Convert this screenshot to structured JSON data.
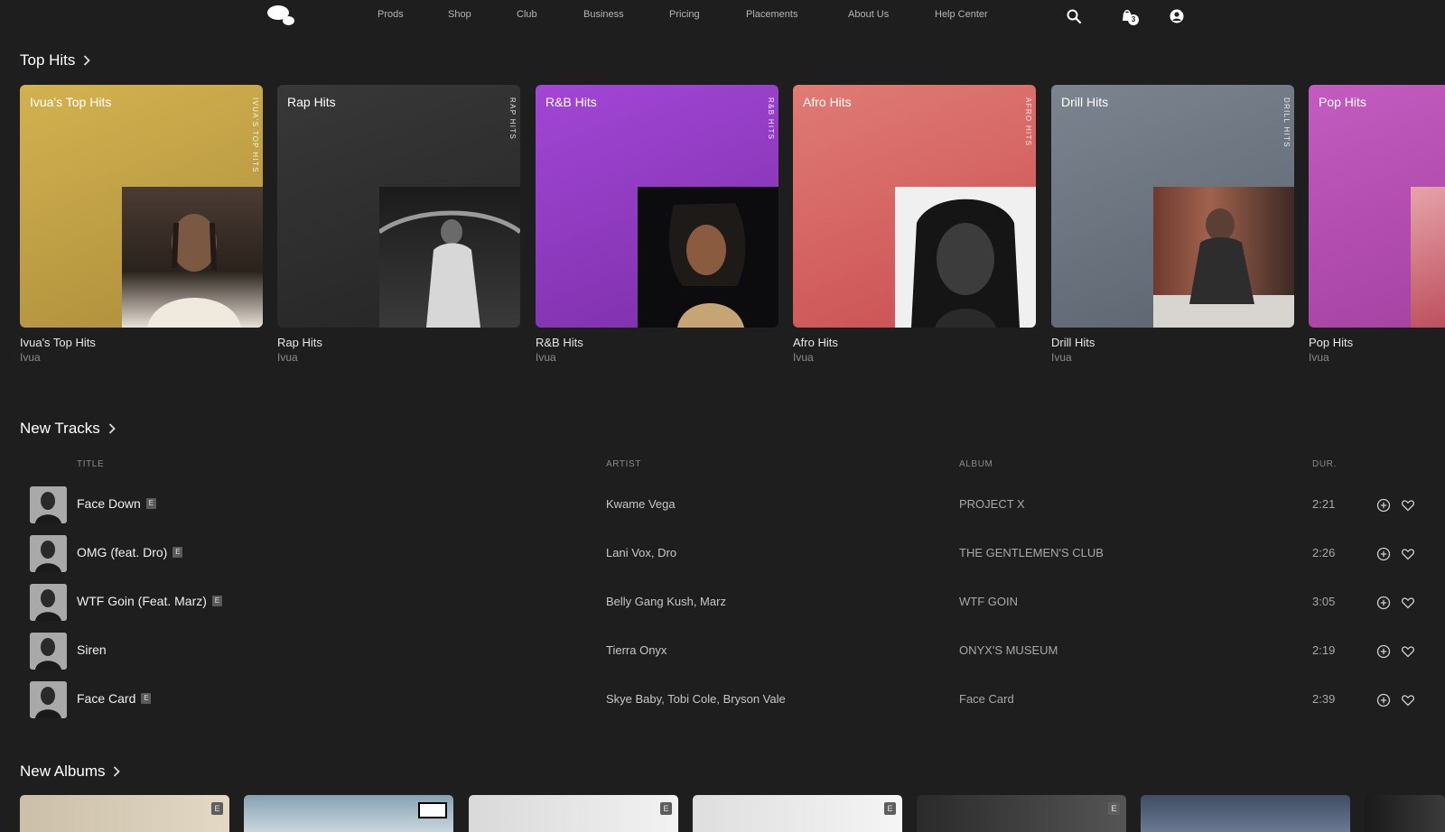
{
  "nav": {
    "links": [
      "Prods",
      "Shop",
      "Club",
      "Business",
      "Pricing",
      "Placements",
      "About Us",
      "Help Center"
    ],
    "cart_count": "3",
    "icons": [
      "search-icon",
      "shopping-bag-icon",
      "account-icon"
    ]
  },
  "top_hits": {
    "title": "Top Hits",
    "cards": [
      {
        "label": "Ivua's Top Hits",
        "vertical": "IVUA'S TOP HITS",
        "name": "Ivua's Top Hits",
        "owner": "Ivua"
      },
      {
        "label": "Rap Hits",
        "vertical": "RAP HITS",
        "name": "Rap Hits",
        "owner": "Ivua"
      },
      {
        "label": "R&B Hits",
        "vertical": "R&B HITS",
        "name": "R&B Hits",
        "owner": "Ivua"
      },
      {
        "label": "Afro Hits",
        "vertical": "AFRO HITS",
        "name": "Afro Hits",
        "owner": "Ivua"
      },
      {
        "label": "Drill Hits",
        "vertical": "DRILL HITS",
        "name": "Drill Hits",
        "owner": "Ivua"
      },
      {
        "label": "Pop Hits",
        "vertical": "",
        "name": "Pop Hits",
        "owner": "Ivua"
      }
    ]
  },
  "new_tracks": {
    "title": "New Tracks",
    "columns": {
      "title": "TITLE",
      "artist": "ARTIST",
      "album": "ALBUM",
      "duration": "DUR."
    },
    "rows": [
      {
        "title": "Face Down",
        "explicit": "E",
        "artist": "Kwame Vega",
        "album": "PROJECT X",
        "duration": "2:21"
      },
      {
        "title": "OMG (feat. Dro)",
        "explicit": "E",
        "artist": "Lani Vox, Dro",
        "album": "THE GENTLEMEN'S CLUB",
        "duration": "2:26"
      },
      {
        "title": "WTF Goin (Feat. Marz)",
        "explicit": "E",
        "artist": "Belly Gang Kush, Marz",
        "album": "WTF GOIN",
        "duration": "3:05"
      },
      {
        "title": "Siren",
        "explicit": "",
        "artist": "Tierra Onyx",
        "album": "ONYX'S MUSEUM",
        "duration": "2:19"
      },
      {
        "title": "Face Card",
        "explicit": "E",
        "artist": "Skye Baby, Tobi Cole, Bryson Vale",
        "album": "Face Card",
        "duration": "2:39"
      }
    ]
  },
  "new_albums": {
    "title": "New Albums",
    "badges": [
      "E",
      "PARENTAL ADVISORY",
      "E",
      "E",
      "E",
      "",
      ""
    ]
  },
  "colors": {
    "background": "#1e1e1e",
    "card_gold": "#c9a84a",
    "card_dark": "#2e2e2e",
    "card_purple": "#9640c8",
    "card_coral": "#d9605e",
    "card_slate": "#6c7580",
    "card_pink": "#b54cb0"
  }
}
